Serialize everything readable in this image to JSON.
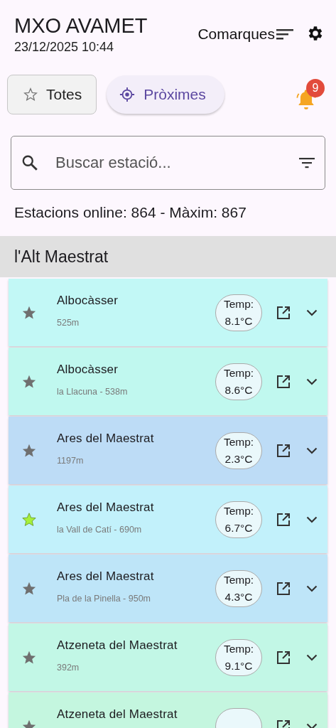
{
  "header": {
    "title": "MXO AVAMET",
    "datetime": "23/12/2025 10:44",
    "region_button": "Comarques"
  },
  "filters": [
    {
      "label": "Totes",
      "kind": "favorites",
      "selected": true
    },
    {
      "label": "Pròximes",
      "kind": "nearby",
      "selected": false
    }
  ],
  "notifications": {
    "count": "9"
  },
  "search": {
    "placeholder": "Buscar estació..."
  },
  "stats": "Estacions online: 864 - Màxim: 867",
  "section": "l'Alt Maestrat",
  "stations": [
    {
      "name": "Albocàsser",
      "detail": "525m",
      "temp_label": "Temp:",
      "temp": "8.1°C",
      "favorite": false,
      "color": "#c2f8f6"
    },
    {
      "name": "Albocàsser",
      "detail": "la Llacuna  - 538m",
      "temp_label": "Temp:",
      "temp": "8.6°C",
      "favorite": false,
      "color": "#c0f8ef"
    },
    {
      "name": "Ares del Maestrat",
      "detail": "1197m",
      "temp_label": "Temp:",
      "temp": "2.3°C",
      "favorite": false,
      "color": "#bddcf6"
    },
    {
      "name": "Ares del Maestrat",
      "detail": "la Vall de Catí  - 690m",
      "temp_label": "Temp:",
      "temp": "6.7°C",
      "favorite": true,
      "color": "#c2f1fb"
    },
    {
      "name": "Ares del Maestrat",
      "detail": "Pla de la Pinella - 950m",
      "temp_label": "Temp:",
      "temp": "4.3°C",
      "favorite": false,
      "color": "#bee5f8"
    },
    {
      "name": "Atzeneta del Maestrat",
      "detail": "392m",
      "temp_label": "Temp:",
      "temp": "9.1°C",
      "favorite": false,
      "color": "#c2f7e6"
    },
    {
      "name": "Atzeneta del Maestrat",
      "favorite": false,
      "color": "#c4f6df"
    }
  ]
}
